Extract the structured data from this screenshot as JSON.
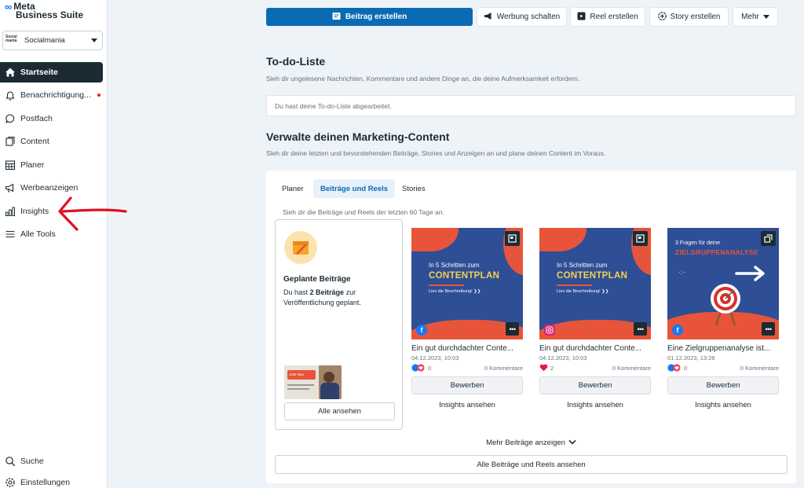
{
  "brand": {
    "line1": "Meta",
    "line2": "Business Suite"
  },
  "account": {
    "avatar_text": "Social mania",
    "name": "Socialmania"
  },
  "nav": {
    "items": [
      {
        "label": "Startseite",
        "icon": "home-icon"
      },
      {
        "label": "Benachrichtigung...",
        "icon": "bell-icon"
      },
      {
        "label": "Postfach",
        "icon": "chat-bubble-icon"
      },
      {
        "label": "Content",
        "icon": "content-icon"
      },
      {
        "label": "Planer",
        "icon": "calendar-grid-icon"
      },
      {
        "label": "Werbeanzeigen",
        "icon": "megaphone-icon"
      },
      {
        "label": "Insights",
        "icon": "bar-chart-icon"
      },
      {
        "label": "Alle Tools",
        "icon": "menu-icon"
      }
    ],
    "bottom": [
      {
        "label": "Suche",
        "icon": "search-icon"
      },
      {
        "label": "Einstellungen",
        "icon": "gear-icon"
      }
    ]
  },
  "toolbar": {
    "create_post": "Beitrag erstellen",
    "ads": "Werbung schalten",
    "reel": "Reel erstellen",
    "story": "Story erstellen",
    "more": "Mehr"
  },
  "todo": {
    "title": "To-do-Liste",
    "subtitle": "Sieh dir ungelesene Nachrichten, Kommentare und andere Dinge an, die deine Aufmerksamkeit erfordern.",
    "empty": "Du hast deine To-do-Liste abgearbeitet."
  },
  "marketing": {
    "title": "Verwalte deinen Marketing-Content",
    "subtitle": "Sieh dir deine letzten und bevorstehenden Beiträge, Stories und Anzeigen an und plane deinen Content im Voraus.",
    "tabs": [
      "Planer",
      "Beiträge und Reels",
      "Stories"
    ],
    "tab_sub": "Sieh dir die Beiträge und Reels der letzten 60 Tage an.",
    "planned": {
      "title": "Geplante Beiträge",
      "desc_pre": "Du hast ",
      "desc_count": "2 Beiträge",
      "desc_post": " zur Veröffentlichung geplant.",
      "thumb_text": "Jetzt Neu",
      "all": "Alle ansehen"
    },
    "posts": [
      {
        "img_line1": "In 5 Schritten zum",
        "img_line2": "CONTENTPLAN",
        "img_line3": "Lies die Beschreibung! ❯❯",
        "title": "Ein gut durchdachter Conte...",
        "date": "04.12.2023, 10:03",
        "reactions": "0",
        "comments": "0 Kommentare",
        "platform": "facebook"
      },
      {
        "img_line1": "In 5 Schritten zum",
        "img_line2": "CONTENTPLAN",
        "img_line3": "Lies die Beschreibung! ❯❯",
        "title": "Ein gut durchdachter Conte...",
        "date": "04.12.2023, 10:03",
        "reactions": "2",
        "comments": "0 Kommentare",
        "platform": "instagram"
      },
      {
        "img_line1": "3 Fragen für deine",
        "img_line2": "ZIELGRUPPENANALYSE",
        "img_line3": "",
        "title": "Eine Zielgruppenanalyse ist...",
        "date": "01.12.2023, 13:28",
        "reactions": "0",
        "comments": "0 Kommentare",
        "platform": "facebook"
      }
    ],
    "boost": "Bewerben",
    "insights": "Insights ansehen",
    "more_posts": "Mehr Beiträge anzeigen",
    "all_reels": "Alle Beiträge und Reels ansehen"
  },
  "colors": {
    "primary": "#0a6bb3",
    "sidebar_active": "#1c2b33",
    "accent_red": "#e41e3f",
    "post_bg": "#2e4e96",
    "post_accent": "#e8543a",
    "post_yellow": "#f5d34a"
  }
}
